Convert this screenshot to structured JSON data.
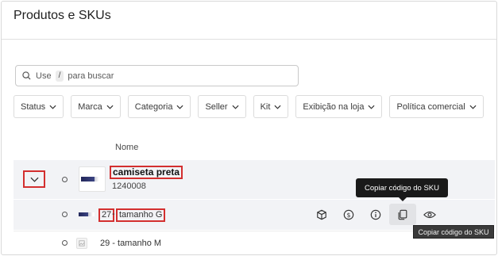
{
  "page": {
    "title": "Produtos e SKUs"
  },
  "search": {
    "prefix": "Use",
    "shortcut": "/",
    "suffix": "para buscar"
  },
  "filters": [
    {
      "label": "Status"
    },
    {
      "label": "Marca"
    },
    {
      "label": "Categoria"
    },
    {
      "label": "Seller"
    },
    {
      "label": "Kit"
    },
    {
      "label": "Exibição na loja"
    },
    {
      "label": "Política comercial"
    }
  ],
  "table": {
    "column_name": "Nome"
  },
  "product": {
    "name": "camiseta preta",
    "id": "1240008"
  },
  "skus": [
    {
      "number": "27",
      "separator": " - ",
      "name": "tamanho G",
      "full_text": "27 - tamanho G"
    },
    {
      "number": "29",
      "separator": " - ",
      "name": "tamanho M",
      "full_text": "29 - tamanho M"
    }
  ],
  "actions": [
    {
      "icon": "cube-icon"
    },
    {
      "icon": "price-icon"
    },
    {
      "icon": "info-icon"
    },
    {
      "icon": "copy-icon"
    },
    {
      "icon": "eye-icon"
    }
  ],
  "tooltips": {
    "copy_sku": "Copiar código do SKU",
    "copy_sku_native": "Copiar código do SKU"
  },
  "colors": {
    "highlight": "#d32f2f",
    "row_bg": "#f2f3f6",
    "tooltip_bg": "#1a1a1a"
  }
}
